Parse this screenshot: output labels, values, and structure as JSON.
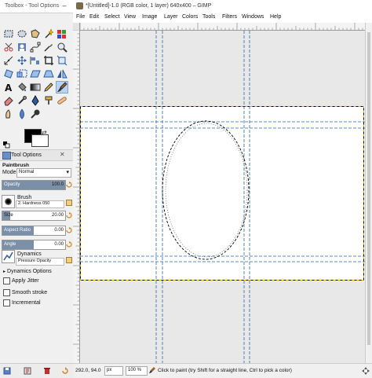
{
  "toolbox": {
    "title": "Toolbox - Tool Options",
    "tool_options_tab": "Tool Options",
    "tool_name": "Paintbrush",
    "mode_label": "Mode",
    "mode_value": "Normal",
    "opacity": {
      "label": "Opacity",
      "value": "100.0",
      "fraction": 1.0
    },
    "brush_label": "Brush",
    "brush_value": "2. Hardness 050",
    "size": {
      "label": "Size",
      "value": "20.00",
      "fraction": 0.12
    },
    "aspect": {
      "label": "Aspect Ratio",
      "value": "0.00",
      "fraction": 0.5
    },
    "angle": {
      "label": "Angle",
      "value": "0.00",
      "fraction": 0.5
    },
    "dynamics_label": "Dynamics",
    "dynamics_value": "Pressure Opacity",
    "dynamics_options": "Dynamics Options",
    "apply_jitter": "Apply Jitter",
    "smooth_stroke": "Smooth stroke",
    "incremental": "Incremental",
    "fg_color": "#000000",
    "bg_color": "#ffffff"
  },
  "image_window": {
    "title": "*[Untitled]-1.0 (RGB color, 1 layer) 640x400 – GIMP",
    "menus": [
      "File",
      "Edit",
      "Select",
      "View",
      "Image",
      "Layer",
      "Colors",
      "Tools",
      "Filters",
      "Windows",
      "Help"
    ],
    "status": {
      "coords": "292.0, 94.0",
      "unit": "px",
      "zoom": "100 %",
      "message": "Click to paint (try Shift for a straight line, Ctrl to pick a color)"
    }
  }
}
